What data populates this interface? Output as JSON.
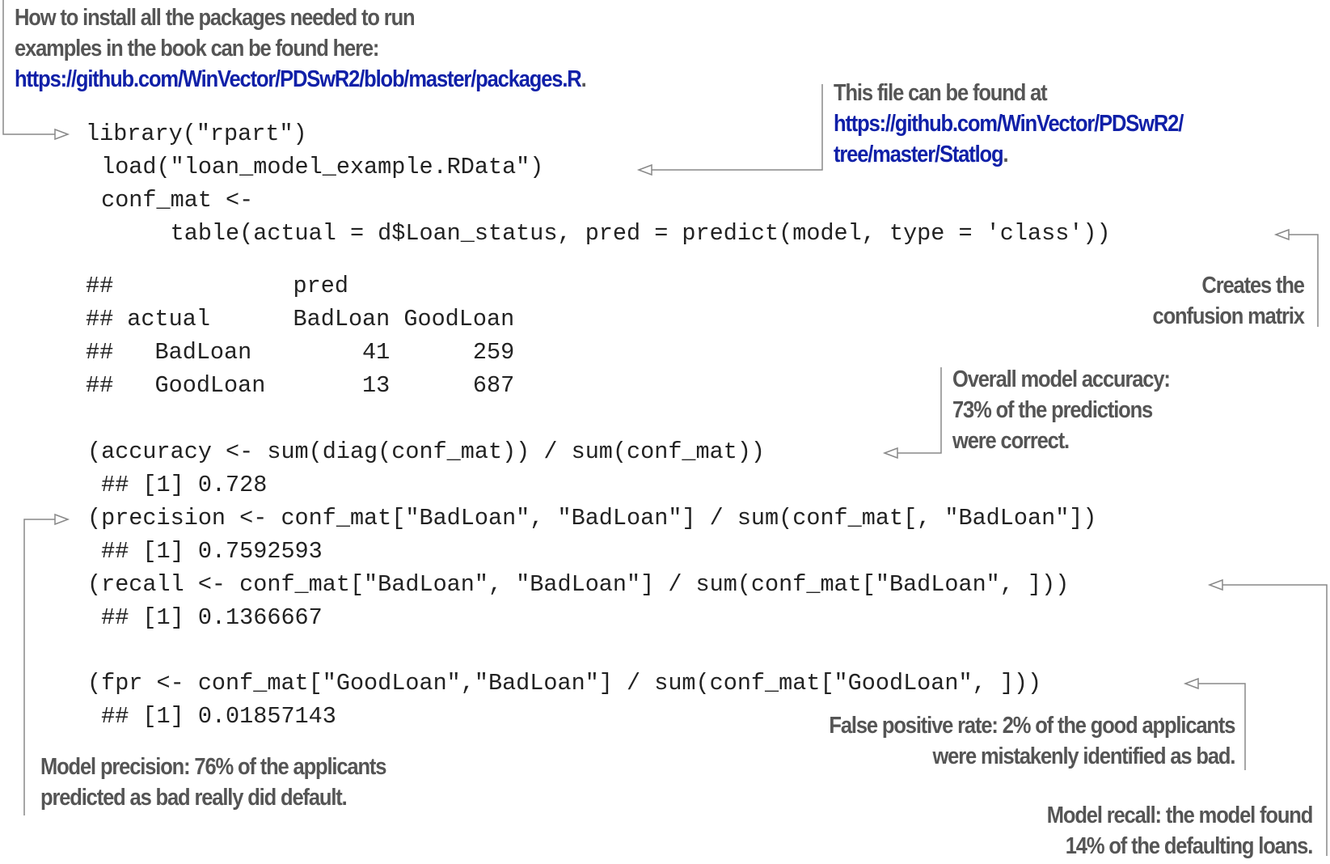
{
  "code": [
    "library(\"rpart\")",
    " load(\"loan_model_example.RData\")",
    " conf_mat <-",
    "      table(actual = d$Loan_status, pred = predict(model, type = 'class'))",
    "##             pred",
    "## actual      BadLoan GoodLoan",
    "##   BadLoan        41      259",
    "##   GoodLoan       13      687",
    "(accuracy <- sum(diag(conf_mat)) / sum(conf_mat))",
    " ## [1] 0.728",
    "(precision <- conf_mat[\"BadLoan\", \"BadLoan\"] / sum(conf_mat[, \"BadLoan\"])",
    " ## [1] 0.7592593",
    "(recall <- conf_mat[\"BadLoan\", \"BadLoan\"] / sum(conf_mat[\"BadLoan\", ]))",
    " ## [1] 0.1366667",
    "(fpr <- conf_mat[\"GoodLoan\",\"BadLoan\"] / sum(conf_mat[\"GoodLoan\", ]))",
    " ## [1] 0.01857143"
  ],
  "annotations": {
    "packages": {
      "line1": "How to install all the packages needed to run",
      "line2": "examples in the book can be found here:",
      "link": "https://github.com/WinVector/PDSwR2/blob/master/packages.R",
      "suffix": "."
    },
    "file": {
      "line1": "This file can be found at",
      "link1": "https://github.com/WinVector/PDSwR2/",
      "link2": "tree/master/Statlog",
      "suffix": "."
    },
    "confusion": {
      "line1": "Creates the",
      "line2": "confusion matrix"
    },
    "accuracy": {
      "line1": "Overall model accuracy:",
      "line2": "73% of the predictions",
      "line3": "were correct."
    },
    "fpr": {
      "line1": "False positive rate: 2% of the good applicants",
      "line2": "were mistakenly identified as bad."
    },
    "precision": {
      "line1": "Model precision: 76% of the applicants",
      "line2": "predicted as bad really did default."
    },
    "recall": {
      "line1": "Model recall: the model found",
      "line2": "14% of the defaulting loans."
    }
  },
  "colors": {
    "link": "#1020a8",
    "annotation_text": "#555555",
    "code_text": "#222222",
    "callout_line": "#888888"
  }
}
